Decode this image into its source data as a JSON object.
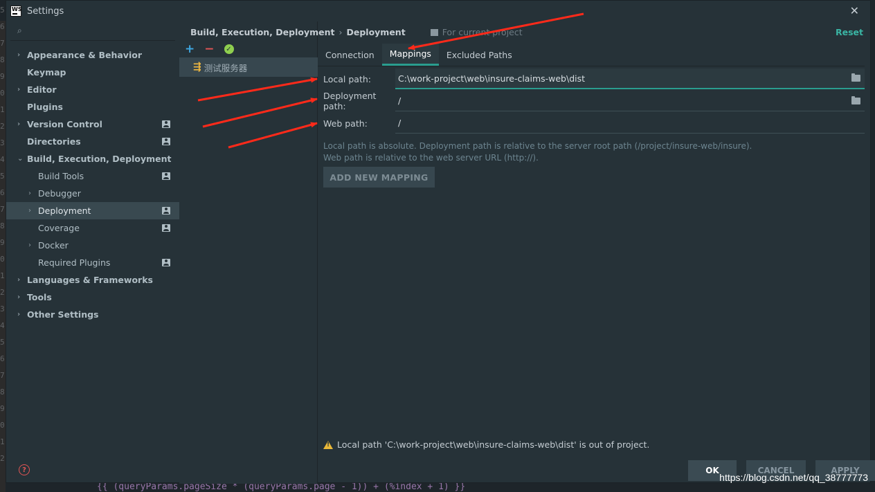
{
  "window": {
    "title": "Settings",
    "logo_text": "WS",
    "close_glyph": "✕"
  },
  "search": {
    "placeholder": ""
  },
  "nav": {
    "items": [
      {
        "label": "Appearance & Behavior",
        "level": 0,
        "expandable": true,
        "bold": true
      },
      {
        "label": "Keymap",
        "level": 0,
        "expandable": false,
        "bold": true
      },
      {
        "label": "Editor",
        "level": 0,
        "expandable": true,
        "bold": true
      },
      {
        "label": "Plugins",
        "level": 0,
        "expandable": false,
        "bold": true
      },
      {
        "label": "Version Control",
        "level": 0,
        "expandable": true,
        "bold": true,
        "project_icon": true
      },
      {
        "label": "Directories",
        "level": 0,
        "expandable": false,
        "bold": true,
        "project_icon": true
      },
      {
        "label": "Build, Execution, Deployment",
        "level": 0,
        "expanded": true,
        "bold": true
      },
      {
        "label": "Build Tools",
        "level": 1,
        "project_icon": true
      },
      {
        "label": "Debugger",
        "level": 1,
        "expandable": true
      },
      {
        "label": "Deployment",
        "level": 1,
        "expandable": true,
        "selected": true,
        "project_icon": true
      },
      {
        "label": "Coverage",
        "level": 1,
        "project_icon": true
      },
      {
        "label": "Docker",
        "level": 1,
        "expandable": true
      },
      {
        "label": "Required Plugins",
        "level": 1,
        "project_icon": true
      },
      {
        "label": "Languages & Frameworks",
        "level": 0,
        "expandable": true,
        "bold": true
      },
      {
        "label": "Tools",
        "level": 0,
        "expandable": true,
        "bold": true
      },
      {
        "label": "Other Settings",
        "level": 0,
        "expandable": true,
        "bold": true
      }
    ]
  },
  "breadcrumb": {
    "parent": "Build, Execution, Deployment",
    "separator": "›",
    "current": "Deployment",
    "scope": "For current project"
  },
  "reset_label": "Reset",
  "toolbar": {
    "add": "+",
    "remove": "−",
    "check": "✓"
  },
  "servers": [
    {
      "name": "测试服务器",
      "icon": "ftp-server-icon"
    }
  ],
  "tabs": [
    {
      "label": "Connection",
      "active": false
    },
    {
      "label": "Mappings",
      "active": true
    },
    {
      "label": "Excluded Paths",
      "active": false
    }
  ],
  "mapping": {
    "local_path_label": "Local path:",
    "local_path_value": "C:\\work-project\\web\\insure-claims-web\\dist",
    "deployment_path_label": "Deployment path:",
    "deployment_path_value": "/",
    "web_path_label": "Web path:",
    "web_path_value": "/",
    "hint_line1": "Local path is absolute. Deployment path is relative to the server root path (/project/insure-web/insure).",
    "hint_line2": "Web path is relative to the web server URL (http://).",
    "add_button": "ADD NEW MAPPING"
  },
  "warning": "Local path 'C:\\work-project\\web\\insure-claims-web\\dist' is out of project.",
  "buttons": {
    "ok": "OK",
    "cancel": "CANCEL",
    "apply": "APPLY"
  },
  "help_glyph": "?",
  "watermark": "https://blog.csdn.net/qq_38777773",
  "background": {
    "gutter_numbers": [
      "5",
      "6",
      "7",
      "8",
      "9",
      "0",
      "1",
      "2",
      "3",
      "4",
      "5",
      "6",
      "7",
      "8",
      "9",
      "0",
      "1",
      "2",
      "3",
      "4",
      "5",
      "6",
      "7",
      "8",
      "9",
      "0",
      "1",
      "2"
    ],
    "code_line": "{{ (queryParams.pageSize * (queryParams.page - 1)) + (%index + 1) }}"
  },
  "colors": {
    "accent": "#2a9d8f",
    "annotation_arrow": "#ff2a1a",
    "warning": "#e9b839"
  }
}
